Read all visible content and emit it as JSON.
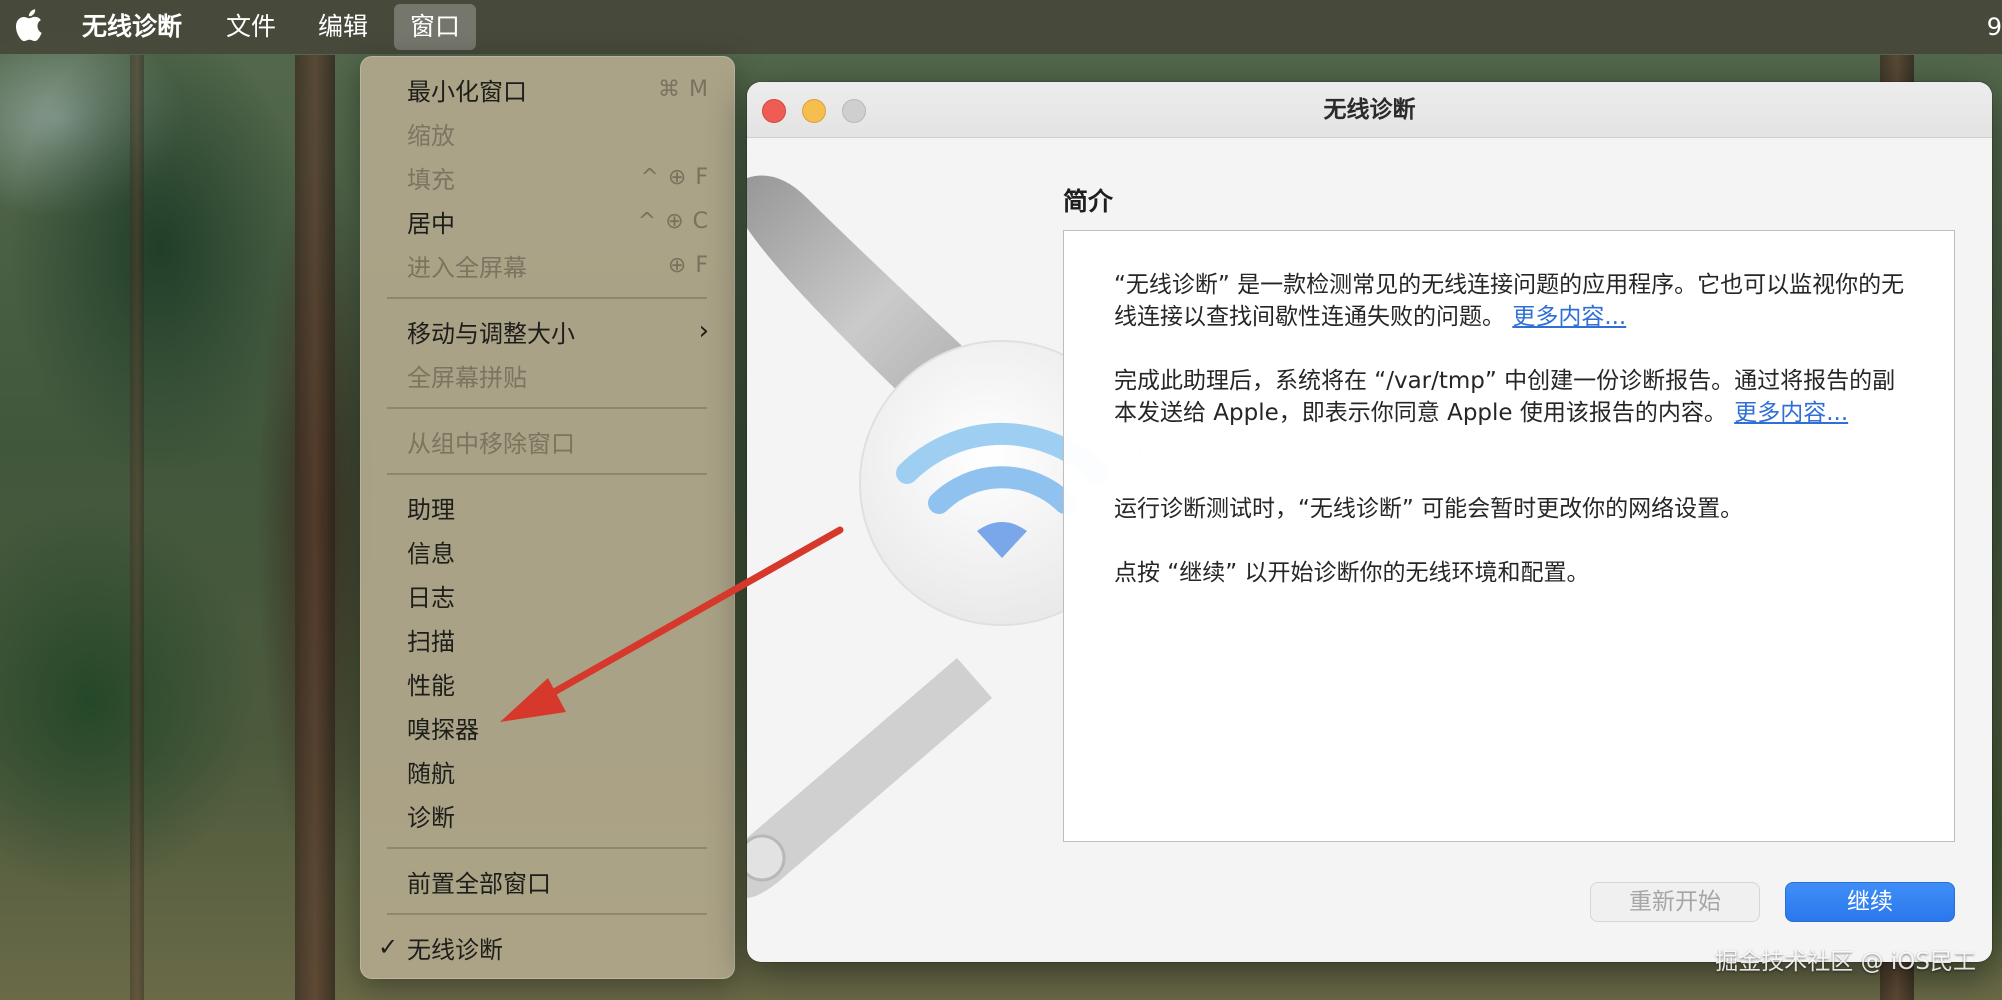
{
  "menubar": {
    "app_name": "无线诊断",
    "menus": [
      "文件",
      "编辑",
      "窗口"
    ],
    "clock_fragment": "9"
  },
  "window_menu": {
    "items": [
      {
        "label": "最小化窗口",
        "shortcut": "⌘ M",
        "enabled": true
      },
      {
        "label": "缩放",
        "shortcut": "",
        "enabled": false
      },
      {
        "label": "填充",
        "shortcut": "^ ⊕ F",
        "enabled": false
      },
      {
        "label": "居中",
        "shortcut": "^ ⊕ C",
        "enabled": true
      },
      {
        "label": "进入全屏幕",
        "shortcut": "⊕ F",
        "enabled": false
      },
      {
        "label": "移动与调整大小",
        "submenu": true,
        "enabled": true
      },
      {
        "label": "全屏幕拼贴",
        "enabled": false
      },
      {
        "label": "从组中移除窗口",
        "enabled": false
      },
      {
        "label": "助理",
        "enabled": true
      },
      {
        "label": "信息",
        "enabled": true
      },
      {
        "label": "日志",
        "enabled": true
      },
      {
        "label": "扫描",
        "enabled": true
      },
      {
        "label": "性能",
        "enabled": true
      },
      {
        "label": "嗅探器",
        "enabled": true
      },
      {
        "label": "随航",
        "enabled": true
      },
      {
        "label": "诊断",
        "enabled": true
      },
      {
        "label": "前置全部窗口",
        "enabled": true
      },
      {
        "label": "无线诊断",
        "checked": true,
        "enabled": true
      }
    ]
  },
  "window": {
    "title": "无线诊断",
    "section_title": "简介",
    "paragraphs": [
      {
        "text": "“无线诊断” 是一款检测常见的无线连接问题的应用程序。它也可以监视你的无线连接以查找间歇性连通失败的问题。",
        "link": "更多内容..."
      },
      {
        "text": "完成此助理后，系统将在 “/var/tmp” 中创建一份诊断报告。通过将报告的副本发送给 Apple，即表示你同意 Apple 使用该报告的内容。",
        "link": "更多内容..."
      },
      {
        "text": "运行诊断测试时，“无线诊断” 可能会暂时更改你的网络设置。",
        "link": ""
      },
      {
        "text": "点按 “继续” 以开始诊断你的无线环境和配置。",
        "link": ""
      }
    ],
    "buttons": {
      "restart": "重新开始",
      "continue": "继续"
    }
  },
  "colors": {
    "accent": "#2a78ec",
    "link": "#2f6fd6",
    "close": "#ee5c54",
    "minimize": "#f6be4f",
    "annotation_arrow": "#d6382c"
  },
  "icons": [
    "apple-logo-icon",
    "wrench-icon",
    "wifi-icon",
    "checkmark-icon",
    "chevron-right-icon"
  ],
  "watermark": "掘金技术社区 @ iOS民工"
}
